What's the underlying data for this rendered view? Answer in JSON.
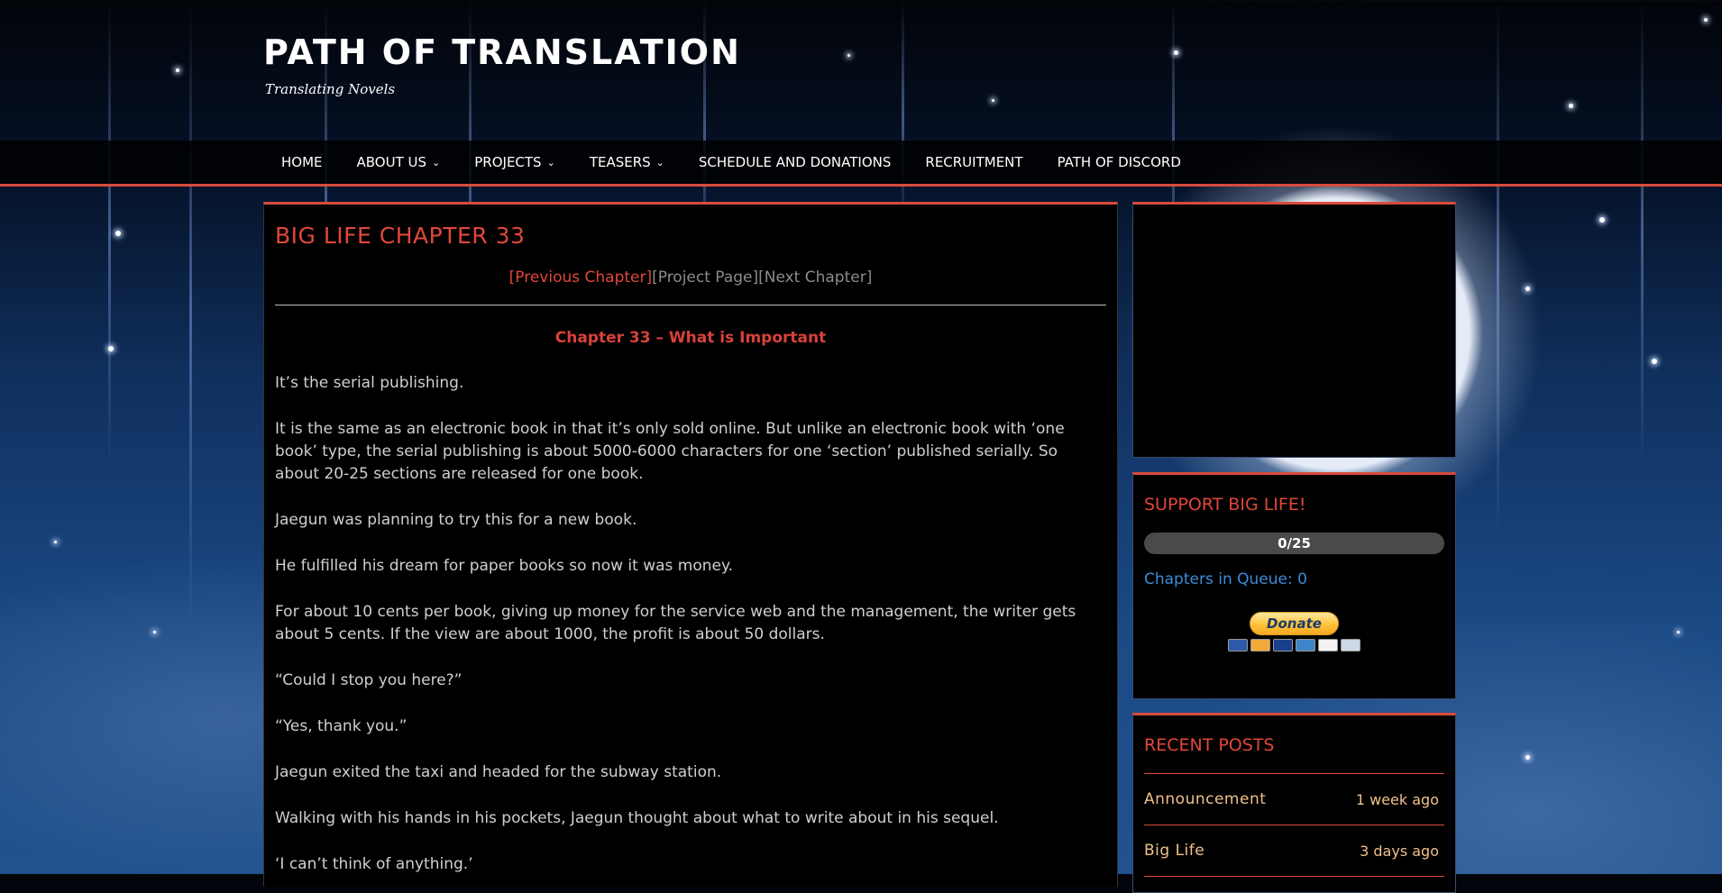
{
  "site": {
    "title": "PATH OF TRANSLATION",
    "tagline": "Translating Novels"
  },
  "nav": {
    "items": [
      {
        "label": "HOME",
        "has_dropdown": false
      },
      {
        "label": "ABOUT US",
        "has_dropdown": true
      },
      {
        "label": "PROJECTS",
        "has_dropdown": true
      },
      {
        "label": "TEASERS",
        "has_dropdown": true
      },
      {
        "label": "SCHEDULE AND DONATIONS",
        "has_dropdown": false
      },
      {
        "label": "RECRUITMENT",
        "has_dropdown": false
      },
      {
        "label": "PATH OF DISCORD",
        "has_dropdown": false
      }
    ],
    "dropdown_icon": "chevron-down-icon"
  },
  "post": {
    "title": "BIG LIFE CHAPTER 33",
    "chapter_nav": {
      "previous": "[Previous Chapter]",
      "project": "[Project Page]",
      "next": "[Next Chapter]"
    },
    "chapter_heading": "Chapter 33 – What is Important",
    "paragraphs": [
      "It’s the serial publishing.",
      "It is the same as an electronic book in that it’s only sold online. But unlike an electronic book with ‘one book’ type, the serial publishing is about 5000-6000 characters for one ‘section’ published serially. So about 20-25 sections are released for one book.",
      "Jaegun was planning to try this for a new book.",
      "He fulfilled his dream for paper books so now it was money.",
      "For about 10 cents per book, giving up money for the service web and the management, the writer gets about 5 cents. If the view are about 1000, the profit is about 50 dollars.",
      "“Could I stop you here?”",
      "“Yes, thank you.”",
      "Jaegun exited the taxi and headed for the subway station.",
      "Walking with his hands in his pockets, Jaegun thought about what to write about in his sequel.",
      "‘I can’t think of anything.’"
    ]
  },
  "sidebar": {
    "support": {
      "title": "SUPPORT BIG LIFE!",
      "progress_text": "0/25",
      "progress_fraction": 0,
      "queue_text": "Chapters in Queue: 0",
      "donate_label": "Donate",
      "payment_icons": [
        "maestro-icon",
        "mastercard-icon",
        "visa-icon",
        "amex-icon",
        "discover-icon",
        "bank-icon"
      ]
    },
    "recent": {
      "title": "RECENT POSTS",
      "items": [
        {
          "name": "Announcement",
          "time": "1 week ago"
        },
        {
          "name": "Big Life",
          "time": "3 days ago"
        }
      ]
    }
  },
  "colors": {
    "accent": "#d94b3c",
    "title_red": "#e0473a",
    "link_blue": "#3d8bd9",
    "recent_gold": "#f0c08a"
  }
}
